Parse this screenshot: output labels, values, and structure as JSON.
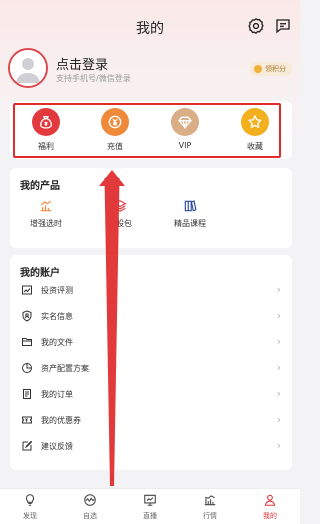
{
  "header": {
    "title": "我的"
  },
  "profile": {
    "login_title": "点击登录",
    "login_subtitle": "支持手机号/微信登录",
    "points_label": "领积分"
  },
  "quick_actions": [
    {
      "label": "福利",
      "icon": "money-bag-icon",
      "color": "#e2393e"
    },
    {
      "label": "充值",
      "icon": "coin-icon",
      "color": "#f08a3b"
    },
    {
      "label": "VIP",
      "icon": "diamond-icon",
      "color": "#d9ad85"
    },
    {
      "label": "收藏",
      "icon": "star-icon",
      "color": "#f2b01e"
    }
  ],
  "products": {
    "title": "我的产品",
    "items": [
      {
        "label": "增强选时",
        "icon": "bar-chart-icon"
      },
      {
        "label": "金股包",
        "icon": "stack-icon"
      },
      {
        "label": "精品课程",
        "icon": "book-icon"
      }
    ]
  },
  "accounts": {
    "title": "我的账户",
    "items": [
      {
        "label": "投资评测",
        "icon": "chart-board-icon"
      },
      {
        "label": "实名信息",
        "icon": "shield-icon"
      },
      {
        "label": "我的文件",
        "icon": "folder-icon"
      },
      {
        "label": "资产配置方案",
        "icon": "pie-chart-icon"
      },
      {
        "label": "我的订单",
        "icon": "order-list-icon"
      },
      {
        "label": "我的优惠券",
        "icon": "coupon-icon"
      },
      {
        "label": "建议反馈",
        "icon": "edit-icon"
      }
    ]
  },
  "tabbar": {
    "items": [
      {
        "label": "发现",
        "icon": "bulb-icon"
      },
      {
        "label": "自选",
        "icon": "wave-icon"
      },
      {
        "label": "直播",
        "icon": "screen-icon"
      },
      {
        "label": "行情",
        "icon": "trend-icon"
      },
      {
        "label": "我的",
        "icon": "person-icon"
      }
    ],
    "active_color": "#d8363c"
  },
  "annotation": {
    "highlight_color": "#e52a2a"
  }
}
